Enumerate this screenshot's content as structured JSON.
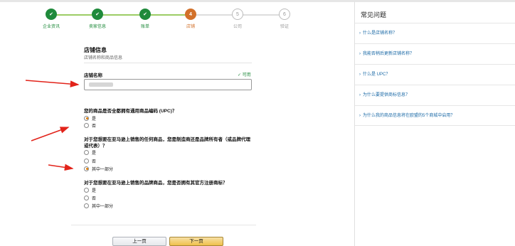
{
  "stepper": {
    "steps": [
      {
        "label": "企业资讯",
        "state": "done",
        "number": ""
      },
      {
        "label": "卖家信息",
        "state": "done",
        "number": ""
      },
      {
        "label": "账单",
        "state": "done",
        "number": ""
      },
      {
        "label": "店铺",
        "state": "current",
        "number": "4"
      },
      {
        "label": "公司",
        "state": "todo",
        "number": "5"
      },
      {
        "label": "验证",
        "state": "todo",
        "number": "6"
      }
    ]
  },
  "form": {
    "section_title": "店铺信息",
    "section_subtitle": "店铺名称和商品信息",
    "store_name_label": "店铺名称",
    "store_name_status": "✓ 可用",
    "q1": {
      "text": "您的商品是否全都拥有通用商品编码 (UPC)？",
      "options": [
        "是",
        "否"
      ],
      "selected": 0
    },
    "q2": {
      "text": "对于您想要在亚马逊上销售的任何商品，您是制造商还是品牌所有者（或品牌代理或代表）？",
      "options": [
        "是",
        "否",
        "其中一部分"
      ],
      "selected": 2
    },
    "q3": {
      "text": "对于您想要在亚马逊上销售的品牌商品，您是否拥有其官方注册商标？",
      "options": [
        "是",
        "否",
        "其中一部分"
      ],
      "selected": -1
    }
  },
  "buttons": {
    "prev": "上一页",
    "next": "下一页"
  },
  "sidebar": {
    "title": "常见问题",
    "items": [
      "什么是店铺名称？",
      "我能否稍后更新店铺名称？",
      "什么是 UPC？",
      "为什么要提供商标信息？",
      "为什么我的商品信息将在欧盟的5个商城中启用？"
    ]
  },
  "colors": {
    "done": "#1f8a3b",
    "current": "#d2712a",
    "link": "#1a69a6",
    "annotation": "#e2231a"
  }
}
